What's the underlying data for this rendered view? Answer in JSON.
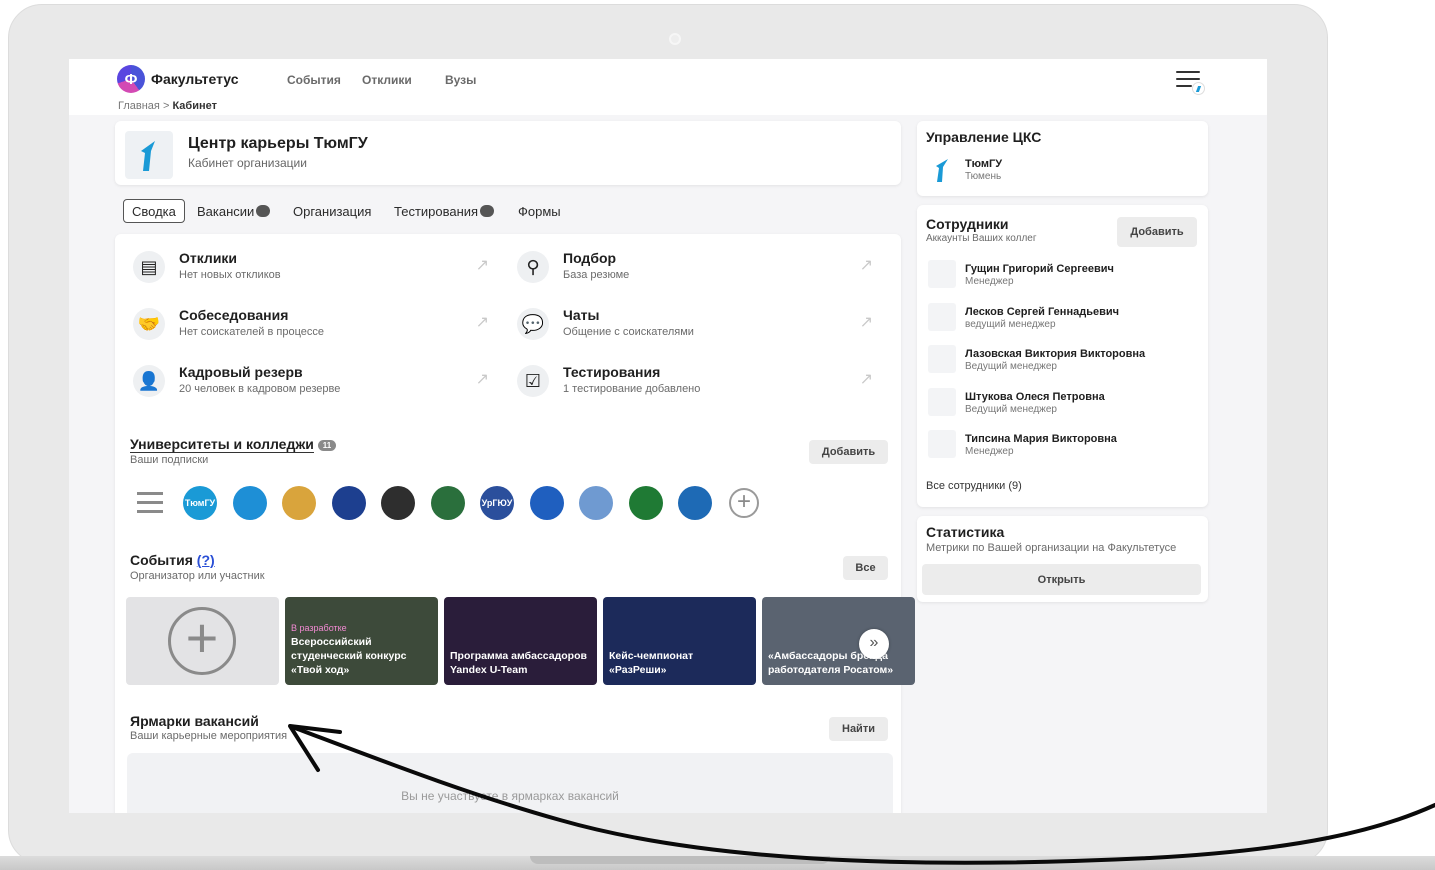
{
  "header": {
    "logo_letter": "Ф",
    "brand": "Факультетус",
    "nav": [
      "События",
      "Отклики",
      "Вузы"
    ],
    "breadcrumb_home": "Главная",
    "breadcrumb_sep": ">",
    "breadcrumb_current": "Кабинет"
  },
  "org": {
    "title": "Центр карьеры ТюмГУ",
    "subtitle": "Кабинет организации"
  },
  "tabs": [
    {
      "label": "Сводка"
    },
    {
      "label": "Вакансии"
    },
    {
      "label": "Организация"
    },
    {
      "label": "Тестирования"
    },
    {
      "label": "Формы"
    }
  ],
  "tiles": [
    {
      "title": "Отклики",
      "sub": "Нет новых откликов",
      "icon": "document-icon"
    },
    {
      "title": "Подбор",
      "sub": "База резюме",
      "icon": "search-icon"
    },
    {
      "title": "Собеседования",
      "sub": "Нет соискателей в процессе",
      "icon": "handshake-icon"
    },
    {
      "title": "Чаты",
      "sub": "Общение с соискателями",
      "icon": "chat-icon"
    },
    {
      "title": "Кадровый резерв",
      "sub": "20 человек в кадровом резерве",
      "icon": "person-clock-icon"
    },
    {
      "title": "Тестирования",
      "sub": "1 тестирование добавлено",
      "icon": "test-icon"
    }
  ],
  "universities": {
    "title": "Университеты и колледжи",
    "count": "11",
    "subtitle": "Ваши подписки",
    "add_label": "Добавить",
    "logos": [
      {
        "name": "ТюмГУ",
        "color": "#1a9ad6"
      },
      {
        "name": "",
        "color": "#1e8fd6"
      },
      {
        "name": "",
        "color": "#d9a43c"
      },
      {
        "name": "",
        "color": "#1d3f8f"
      },
      {
        "name": "",
        "color": "#2e2e2e"
      },
      {
        "name": "",
        "color": "#2a6f3c"
      },
      {
        "name": "УрГЮУ",
        "color": "#2b4f9c"
      },
      {
        "name": "",
        "color": "#1f5fbf"
      },
      {
        "name": "",
        "color": "#6f9ad1"
      },
      {
        "name": "",
        "color": "#1f7a34"
      },
      {
        "name": "",
        "color": "#1e6ab5"
      }
    ]
  },
  "events": {
    "title": "События",
    "help": "(?)",
    "subtitle": "Организатор или участник",
    "all_label": "Все",
    "cards": [
      {
        "tag": "В разработке",
        "title": "Всероссийский студенческий конкурс «Твой ход»",
        "bg": "#3d4a3a"
      },
      {
        "tag": "",
        "title": "Программа амбассадоров Yandex U-Team",
        "bg": "#2a1d3a"
      },
      {
        "tag": "",
        "title": "Кейс-чемпионат «РазРеши»",
        "bg": "#1c2a5a"
      },
      {
        "tag": "",
        "title": "«Амбассадоры бренда работодателя Росатом»",
        "bg": "#5a6370"
      }
    ]
  },
  "fairs": {
    "title": "Ярмарки вакансий",
    "subtitle": "Ваши карьерные мероприятия",
    "find_label": "Найти",
    "empty": "Вы не участвуете в ярмарках вакансий"
  },
  "management": {
    "title": "Управление ЦКС",
    "org_name": "ТюмГУ",
    "org_city": "Тюмень"
  },
  "staff": {
    "title": "Сотрудники",
    "subtitle": "Аккаунты Ваших коллег",
    "add_label": "Добавить",
    "people": [
      {
        "name": "Гущин Григорий Сергеевич",
        "role": "Менеджер"
      },
      {
        "name": "Лесков Сергей Геннадьевич",
        "role": "ведущий менеджер"
      },
      {
        "name": "Лазовская Виктория Викторовна",
        "role": "Ведущий менеджер"
      },
      {
        "name": "Штукова Олеся Петровна",
        "role": "Ведущий менеджер"
      },
      {
        "name": "Типсина Мария Викторовна",
        "role": "Менеджер"
      }
    ],
    "all_label": "Все сотрудники (9)"
  },
  "stats": {
    "title": "Статистика",
    "subtitle": "Метрики по Вашей организации на Факультетусе",
    "open_label": "Открыть"
  }
}
